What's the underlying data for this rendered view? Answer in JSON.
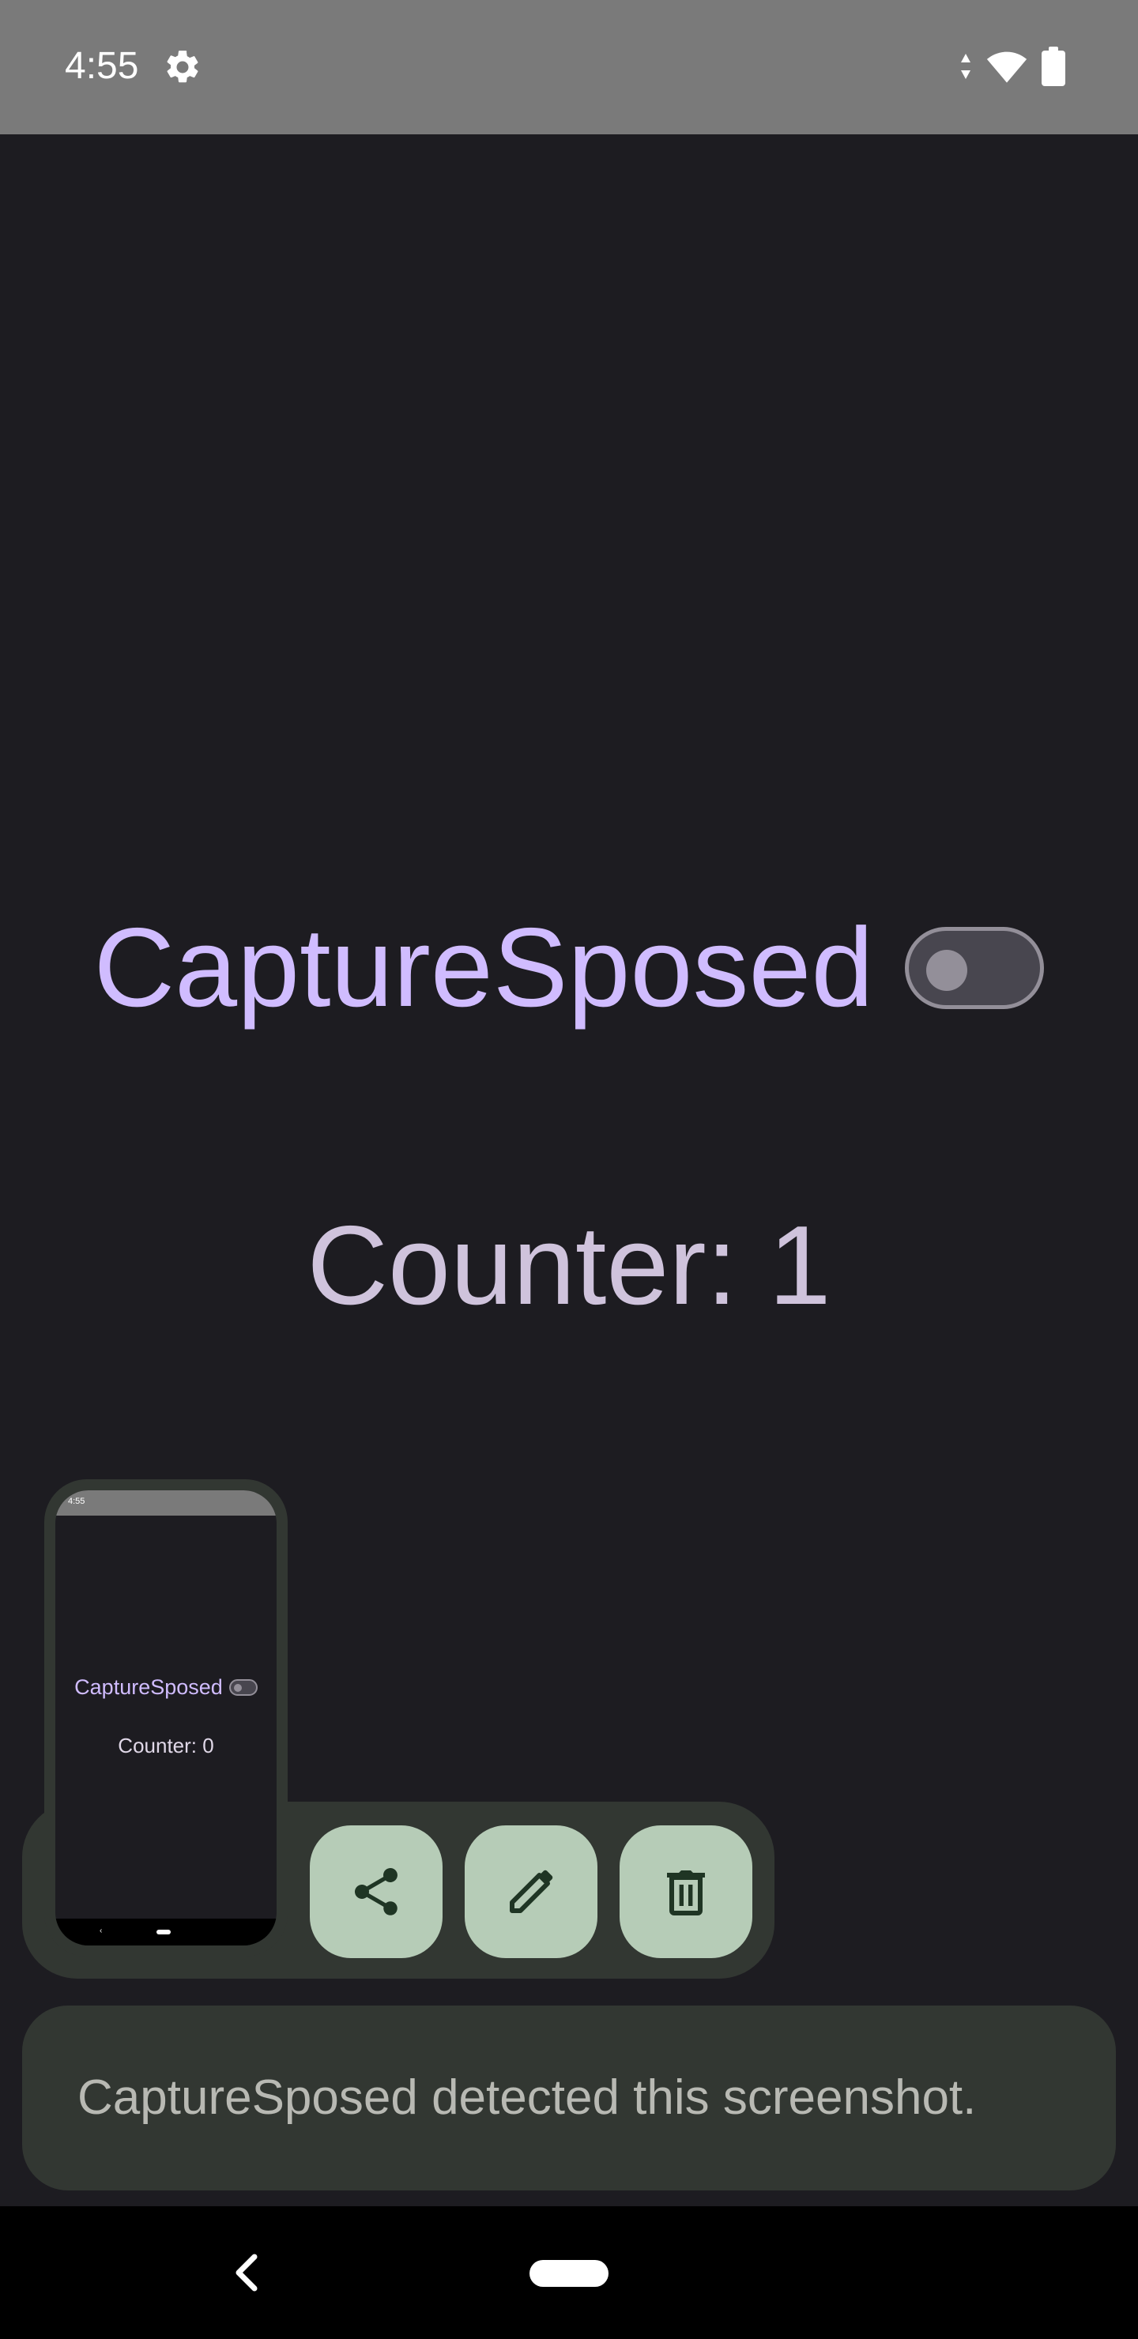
{
  "status_bar": {
    "time": "4:55",
    "icons": [
      "settings-gear-icon",
      "data-arrows-icon",
      "wifi-icon",
      "battery-icon"
    ],
    "background": "#7a7a7a"
  },
  "app": {
    "title": "CaptureSposed",
    "toggle_state": "off",
    "counter_text": "Counter: 1",
    "title_color": "#d0bcff"
  },
  "screenshot_preview": {
    "time": "4:55",
    "title": "CaptureSposed",
    "counter_text": "Counter: 0"
  },
  "actions": [
    {
      "name": "share",
      "icon": "share-icon"
    },
    {
      "name": "edit",
      "icon": "pencil-icon"
    },
    {
      "name": "delete",
      "icon": "trash-icon"
    }
  ],
  "toast": {
    "message": "CaptureSposed detected this screenshot."
  },
  "nav_bar": {
    "icons": [
      "back-icon",
      "home-pill-icon"
    ]
  }
}
